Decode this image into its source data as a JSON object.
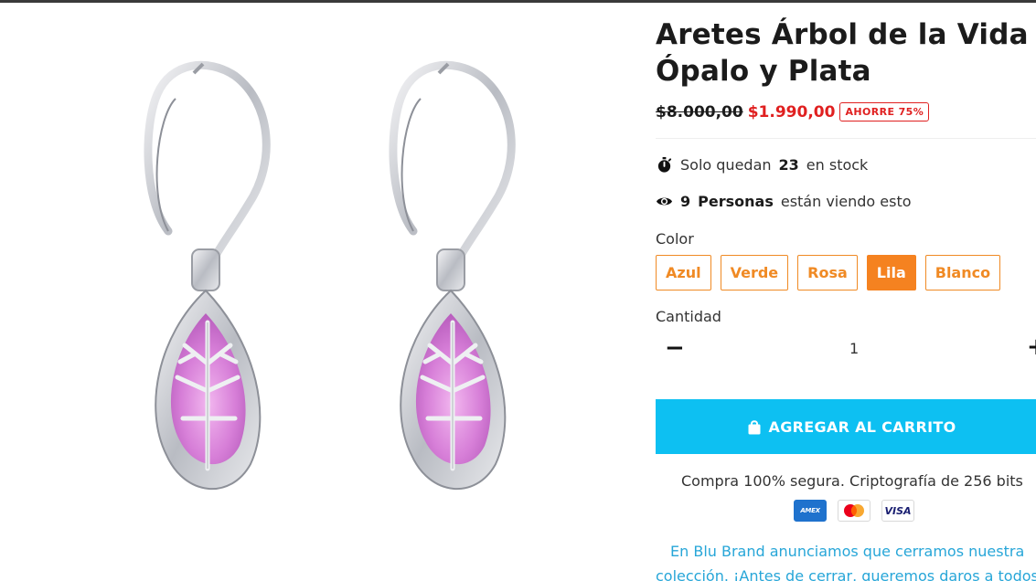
{
  "product": {
    "title_line1": "Aretes Árbol de la Vida en",
    "title_line2": "Ópalo y Plata",
    "old_price": "$8.000,00",
    "new_price": "$1.990,00",
    "save_badge": "AHORRE 75%",
    "image_alt": "Aretes Árbol de la Vida en ópalo lila y plata"
  },
  "stock": {
    "icon": "stopwatch-icon",
    "prefix": "Solo quedan",
    "count": "23",
    "suffix": "en stock"
  },
  "viewers": {
    "icon": "eye-icon",
    "count": "9",
    "people": "Personas",
    "suffix": "están viendo esto"
  },
  "color": {
    "label": "Color",
    "options": [
      "Azul",
      "Verde",
      "Rosa",
      "Lila",
      "Blanco"
    ],
    "selected": "Lila",
    "accent": "#f58220"
  },
  "quantity": {
    "label": "Cantidad",
    "minus": "−",
    "value": "1",
    "plus": "+"
  },
  "cart": {
    "label": "AGREGAR AL CARRITO",
    "icon": "shopping-bag-icon",
    "color": "#0dc0f2"
  },
  "secure": {
    "text": "Compra 100% segura. Criptografía de 256 bits",
    "cards": [
      "AMEX",
      "Mastercard",
      "VISA"
    ]
  },
  "promo": {
    "line1": "En Blu Brand anunciamos que cerramos nuestra",
    "line2": "colección. ¡Antes de cerrar, queremos daros a todos"
  }
}
